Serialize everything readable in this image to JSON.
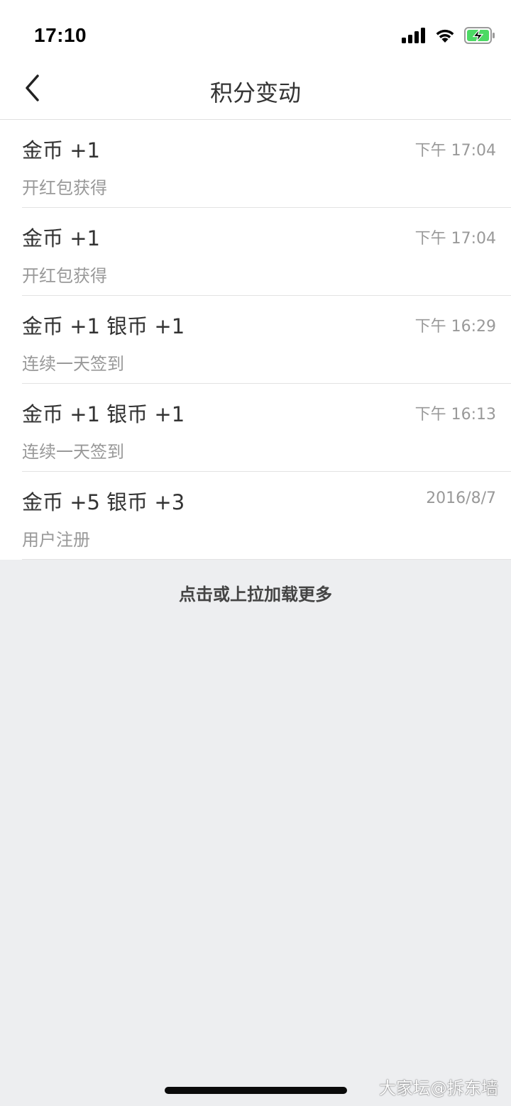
{
  "status_bar": {
    "time": "17:10"
  },
  "nav": {
    "title": "积分变动"
  },
  "records": [
    {
      "title": "金币 +1",
      "time": "下午 17:04",
      "desc": "开红包获得"
    },
    {
      "title": "金币 +1",
      "time": "下午 17:04",
      "desc": "开红包获得"
    },
    {
      "title": "金币 +1 银币 +1",
      "time": "下午 16:29",
      "desc": "连续一天签到"
    },
    {
      "title": "金币 +1 银币 +1",
      "time": "下午 16:13",
      "desc": "连续一天签到"
    },
    {
      "title": "金币 +5 银币 +3",
      "time": "2016/8/7",
      "desc": "用户注册"
    }
  ],
  "load_more": "点击或上拉加载更多",
  "watermark": "大家坛@拆东墙",
  "icons": {
    "back": "chevron-left-icon",
    "signal": "cellular-signal-icon",
    "wifi": "wifi-icon",
    "battery": "battery-charging-icon"
  },
  "colors": {
    "battery_fill": "#4CD964",
    "background": "#EDEEF0"
  }
}
